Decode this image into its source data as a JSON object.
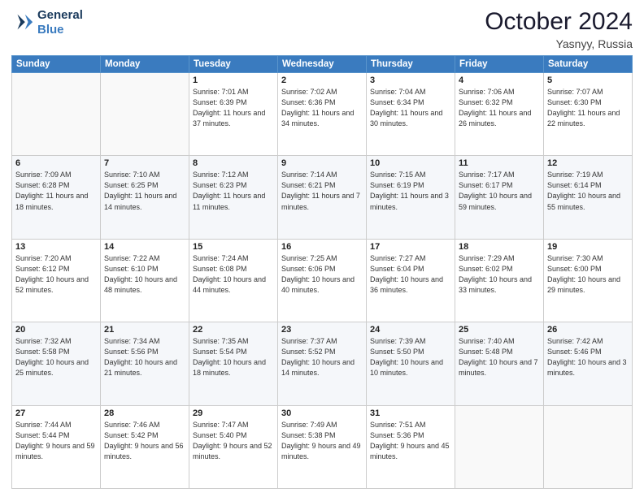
{
  "logo": {
    "line1": "General",
    "line2": "Blue"
  },
  "title": "October 2024",
  "location": "Yasnyy, Russia",
  "days_header": [
    "Sunday",
    "Monday",
    "Tuesday",
    "Wednesday",
    "Thursday",
    "Friday",
    "Saturday"
  ],
  "weeks": [
    [
      {
        "day": "",
        "content": ""
      },
      {
        "day": "",
        "content": ""
      },
      {
        "day": "1",
        "content": "Sunrise: 7:01 AM\nSunset: 6:39 PM\nDaylight: 11 hours\nand 37 minutes."
      },
      {
        "day": "2",
        "content": "Sunrise: 7:02 AM\nSunset: 6:36 PM\nDaylight: 11 hours\nand 34 minutes."
      },
      {
        "day": "3",
        "content": "Sunrise: 7:04 AM\nSunset: 6:34 PM\nDaylight: 11 hours\nand 30 minutes."
      },
      {
        "day": "4",
        "content": "Sunrise: 7:06 AM\nSunset: 6:32 PM\nDaylight: 11 hours\nand 26 minutes."
      },
      {
        "day": "5",
        "content": "Sunrise: 7:07 AM\nSunset: 6:30 PM\nDaylight: 11 hours\nand 22 minutes."
      }
    ],
    [
      {
        "day": "6",
        "content": "Sunrise: 7:09 AM\nSunset: 6:28 PM\nDaylight: 11 hours\nand 18 minutes."
      },
      {
        "day": "7",
        "content": "Sunrise: 7:10 AM\nSunset: 6:25 PM\nDaylight: 11 hours\nand 14 minutes."
      },
      {
        "day": "8",
        "content": "Sunrise: 7:12 AM\nSunset: 6:23 PM\nDaylight: 11 hours\nand 11 minutes."
      },
      {
        "day": "9",
        "content": "Sunrise: 7:14 AM\nSunset: 6:21 PM\nDaylight: 11 hours\nand 7 minutes."
      },
      {
        "day": "10",
        "content": "Sunrise: 7:15 AM\nSunset: 6:19 PM\nDaylight: 11 hours\nand 3 minutes."
      },
      {
        "day": "11",
        "content": "Sunrise: 7:17 AM\nSunset: 6:17 PM\nDaylight: 10 hours\nand 59 minutes."
      },
      {
        "day": "12",
        "content": "Sunrise: 7:19 AM\nSunset: 6:14 PM\nDaylight: 10 hours\nand 55 minutes."
      }
    ],
    [
      {
        "day": "13",
        "content": "Sunrise: 7:20 AM\nSunset: 6:12 PM\nDaylight: 10 hours\nand 52 minutes."
      },
      {
        "day": "14",
        "content": "Sunrise: 7:22 AM\nSunset: 6:10 PM\nDaylight: 10 hours\nand 48 minutes."
      },
      {
        "day": "15",
        "content": "Sunrise: 7:24 AM\nSunset: 6:08 PM\nDaylight: 10 hours\nand 44 minutes."
      },
      {
        "day": "16",
        "content": "Sunrise: 7:25 AM\nSunset: 6:06 PM\nDaylight: 10 hours\nand 40 minutes."
      },
      {
        "day": "17",
        "content": "Sunrise: 7:27 AM\nSunset: 6:04 PM\nDaylight: 10 hours\nand 36 minutes."
      },
      {
        "day": "18",
        "content": "Sunrise: 7:29 AM\nSunset: 6:02 PM\nDaylight: 10 hours\nand 33 minutes."
      },
      {
        "day": "19",
        "content": "Sunrise: 7:30 AM\nSunset: 6:00 PM\nDaylight: 10 hours\nand 29 minutes."
      }
    ],
    [
      {
        "day": "20",
        "content": "Sunrise: 7:32 AM\nSunset: 5:58 PM\nDaylight: 10 hours\nand 25 minutes."
      },
      {
        "day": "21",
        "content": "Sunrise: 7:34 AM\nSunset: 5:56 PM\nDaylight: 10 hours\nand 21 minutes."
      },
      {
        "day": "22",
        "content": "Sunrise: 7:35 AM\nSunset: 5:54 PM\nDaylight: 10 hours\nand 18 minutes."
      },
      {
        "day": "23",
        "content": "Sunrise: 7:37 AM\nSunset: 5:52 PM\nDaylight: 10 hours\nand 14 minutes."
      },
      {
        "day": "24",
        "content": "Sunrise: 7:39 AM\nSunset: 5:50 PM\nDaylight: 10 hours\nand 10 minutes."
      },
      {
        "day": "25",
        "content": "Sunrise: 7:40 AM\nSunset: 5:48 PM\nDaylight: 10 hours\nand 7 minutes."
      },
      {
        "day": "26",
        "content": "Sunrise: 7:42 AM\nSunset: 5:46 PM\nDaylight: 10 hours\nand 3 minutes."
      }
    ],
    [
      {
        "day": "27",
        "content": "Sunrise: 7:44 AM\nSunset: 5:44 PM\nDaylight: 9 hours\nand 59 minutes."
      },
      {
        "day": "28",
        "content": "Sunrise: 7:46 AM\nSunset: 5:42 PM\nDaylight: 9 hours\nand 56 minutes."
      },
      {
        "day": "29",
        "content": "Sunrise: 7:47 AM\nSunset: 5:40 PM\nDaylight: 9 hours\nand 52 minutes."
      },
      {
        "day": "30",
        "content": "Sunrise: 7:49 AM\nSunset: 5:38 PM\nDaylight: 9 hours\nand 49 minutes."
      },
      {
        "day": "31",
        "content": "Sunrise: 7:51 AM\nSunset: 5:36 PM\nDaylight: 9 hours\nand 45 minutes."
      },
      {
        "day": "",
        "content": ""
      },
      {
        "day": "",
        "content": ""
      }
    ]
  ]
}
